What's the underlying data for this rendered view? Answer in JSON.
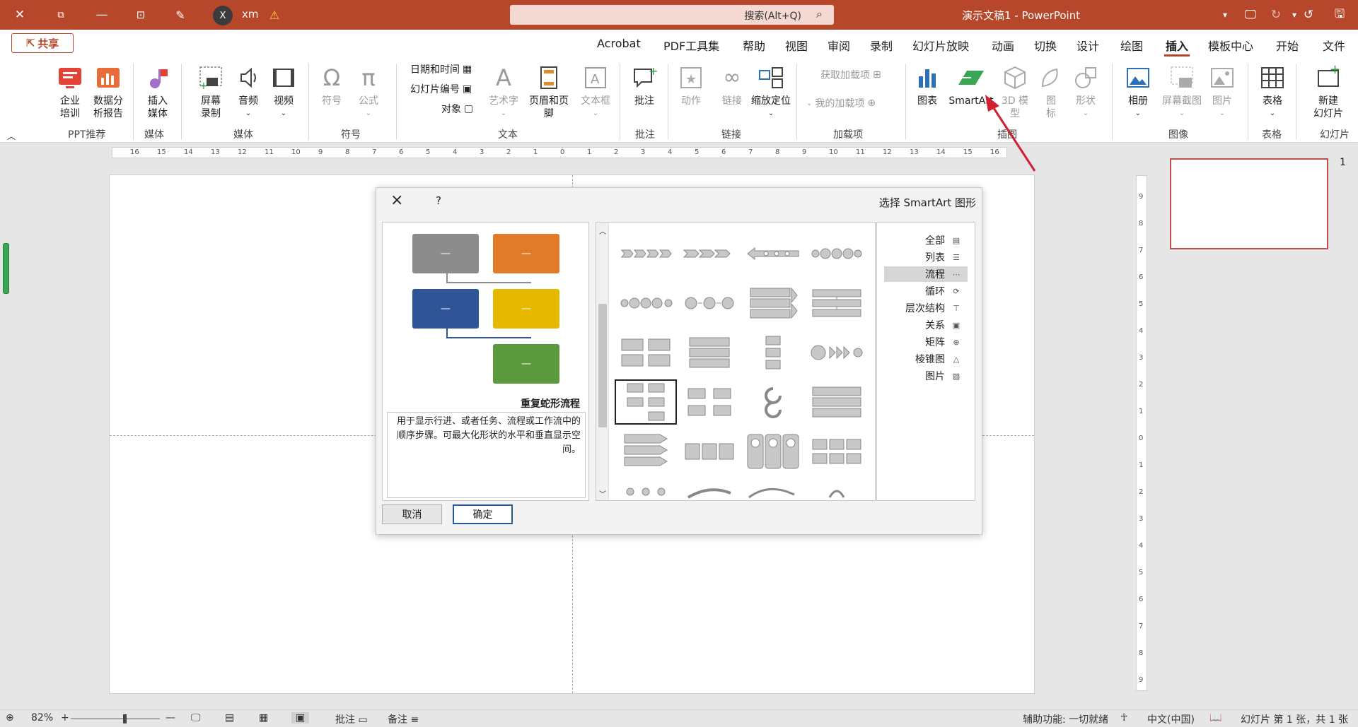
{
  "titlebar": {
    "doc_title": "演示文稿1 - PowerPoint",
    "search_placeholder": "搜索(Alt+Q)",
    "user_initial": "X",
    "user_name": "xm"
  },
  "tabs": {
    "file": "文件",
    "home": "开始",
    "templates": "模板中心",
    "insert": "插入",
    "draw": "绘图",
    "design": "设计",
    "transitions": "切换",
    "animations": "动画",
    "slideshow": "幻灯片放映",
    "record": "录制",
    "review": "审阅",
    "view": "视图",
    "help": "帮助",
    "pdf": "PDF工具集",
    "acrobat": "Acrobat",
    "share": "共享"
  },
  "ribbon": {
    "slides_group": "幻灯片",
    "new_slide": "新建\n幻灯片",
    "tables_group": "表格",
    "table": "表格",
    "images_group": "图像",
    "picture": "图片",
    "screenshot": "屏幕截图",
    "album": "相册",
    "illustrations_group": "插图",
    "shapes": "形状",
    "icons": "图标",
    "models3d": "3D 模型",
    "smartart": "SmartArt",
    "chart": "图表",
    "addins_group": "加载项",
    "get_addins": "获取加载项",
    "my_addins": "我的加载项",
    "links_group": "链接",
    "zoom": "缩放定位",
    "link": "链接",
    "action": "动作",
    "comments_group": "批注",
    "comment": "批注",
    "text_group": "文本",
    "textbox": "文本框",
    "header_footer": "页眉和页脚",
    "wordart": "艺术字",
    "date_time": "日期和时间",
    "slide_number": "幻灯片编号",
    "object": "对象",
    "symbols_group": "符号",
    "equation": "公式",
    "symbol": "符号",
    "media_group": "媒体",
    "video": "视频",
    "audio": "音频",
    "screen_recording": "屏幕\n录制",
    "media2_group": "媒体",
    "insert_media": "插入\n媒体",
    "ppt_group": "PPT推荐",
    "data_report": "数据分\n析报告",
    "training": "企业\n培训"
  },
  "dialog": {
    "title": "选择 SmartArt 图形",
    "help": "?",
    "categories": [
      {
        "label": "全部",
        "icon": "all-icon"
      },
      {
        "label": "列表",
        "icon": "list-icon"
      },
      {
        "label": "流程",
        "icon": "process-icon",
        "selected": true
      },
      {
        "label": "循环",
        "icon": "cycle-icon"
      },
      {
        "label": "层次结构",
        "icon": "hierarchy-icon"
      },
      {
        "label": "关系",
        "icon": "relationship-icon"
      },
      {
        "label": "矩阵",
        "icon": "matrix-icon"
      },
      {
        "label": "棱锥图",
        "icon": "pyramid-icon"
      },
      {
        "label": "图片",
        "icon": "picture-icon"
      }
    ],
    "preview_title": "重复蛇形流程",
    "preview_desc": "用于显示行进、或者任务、流程或工作流中的顺序步骤。可最大化形状的水平和垂直显示空间。",
    "preview_box_text": "—",
    "ok": "确定",
    "cancel": "取消"
  },
  "colors": {
    "accent": "#b7472a",
    "orange": "#e07b2a",
    "gray": "#8c8c8c",
    "blue": "#2f5597",
    "yellow": "#e6b800",
    "green": "#5b9a3c",
    "arrow": "#d22030"
  },
  "thumbnail": {
    "number": "1"
  },
  "statusbar": {
    "slide_info": "幻灯片 第 1 张，共 1 张",
    "language": "中文(中国)",
    "accessibility": "辅助功能: 一切就绪",
    "notes": "备注",
    "comments": "批注",
    "zoom": "82%"
  }
}
